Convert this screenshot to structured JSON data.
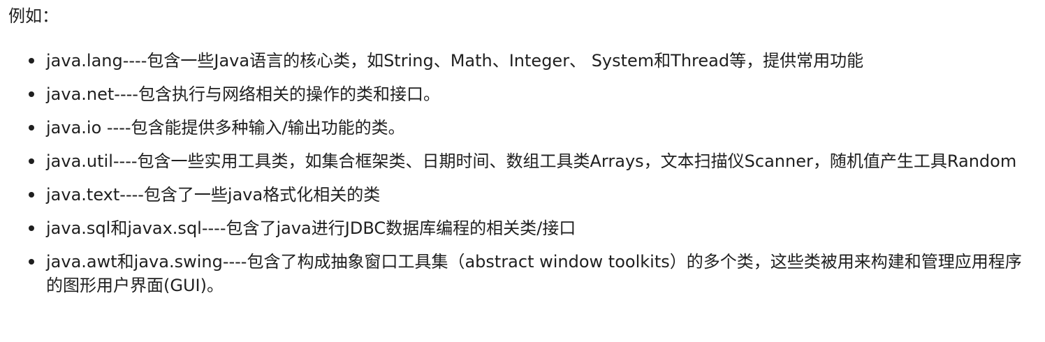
{
  "intro": "例如：",
  "items": [
    "java.lang----包含一些Java语言的核心类，如String、Math、Integer、 System和Thread等，提供常用功能",
    "java.net----包含执行与网络相关的操作的类和接口。",
    "java.io ----包含能提供多种输入/输出功能的类。",
    "java.util----包含一些实用工具类，如集合框架类、日期时间、数组工具类Arrays，文本扫描仪Scanner，随机值产生工具Random",
    "java.text----包含了一些java格式化相关的类",
    "java.sql和javax.sql----包含了java进行JDBC数据库编程的相关类/接口",
    "java.awt和java.swing----包含了构成抽象窗口工具集（abstract window toolkits）的多个类，这些类被用来构建和管理应用程序的图形用户界面(GUI)。"
  ]
}
